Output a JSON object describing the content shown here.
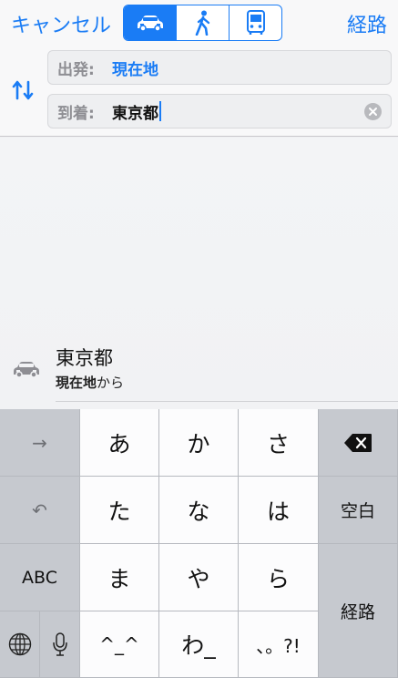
{
  "header": {
    "cancel_label": "キャンセル",
    "route_label": "経路",
    "modes": [
      "car-icon",
      "walk-icon",
      "transit-icon"
    ],
    "active_mode": "car"
  },
  "fields": {
    "from_label": "出発:",
    "from_value": "現在地",
    "to_label": "到着:",
    "to_value": "東京都"
  },
  "suggestion": {
    "title": "東京都",
    "subtitle_bold": "現在地",
    "subtitle_rest": "から",
    "icon": "car-icon"
  },
  "keyboard": {
    "arrow_key": "→",
    "undo_key": "↶",
    "abc_key": "ABC",
    "globe_key": "globe-icon",
    "mic_key": "mic-icon",
    "row1": [
      "あ",
      "か",
      "さ"
    ],
    "row2": [
      "た",
      "な",
      "は"
    ],
    "row3": [
      "ま",
      "や",
      "ら"
    ],
    "row4": [
      "^_^",
      "わ_",
      "、。?!"
    ],
    "delete_key": "delete-icon",
    "space_key": "空白",
    "return_key": "経路"
  },
  "colors": {
    "accent": "#1a7cf5",
    "keyboard_bg": "#d1d4d9",
    "key_light": "#fcfcfd"
  }
}
